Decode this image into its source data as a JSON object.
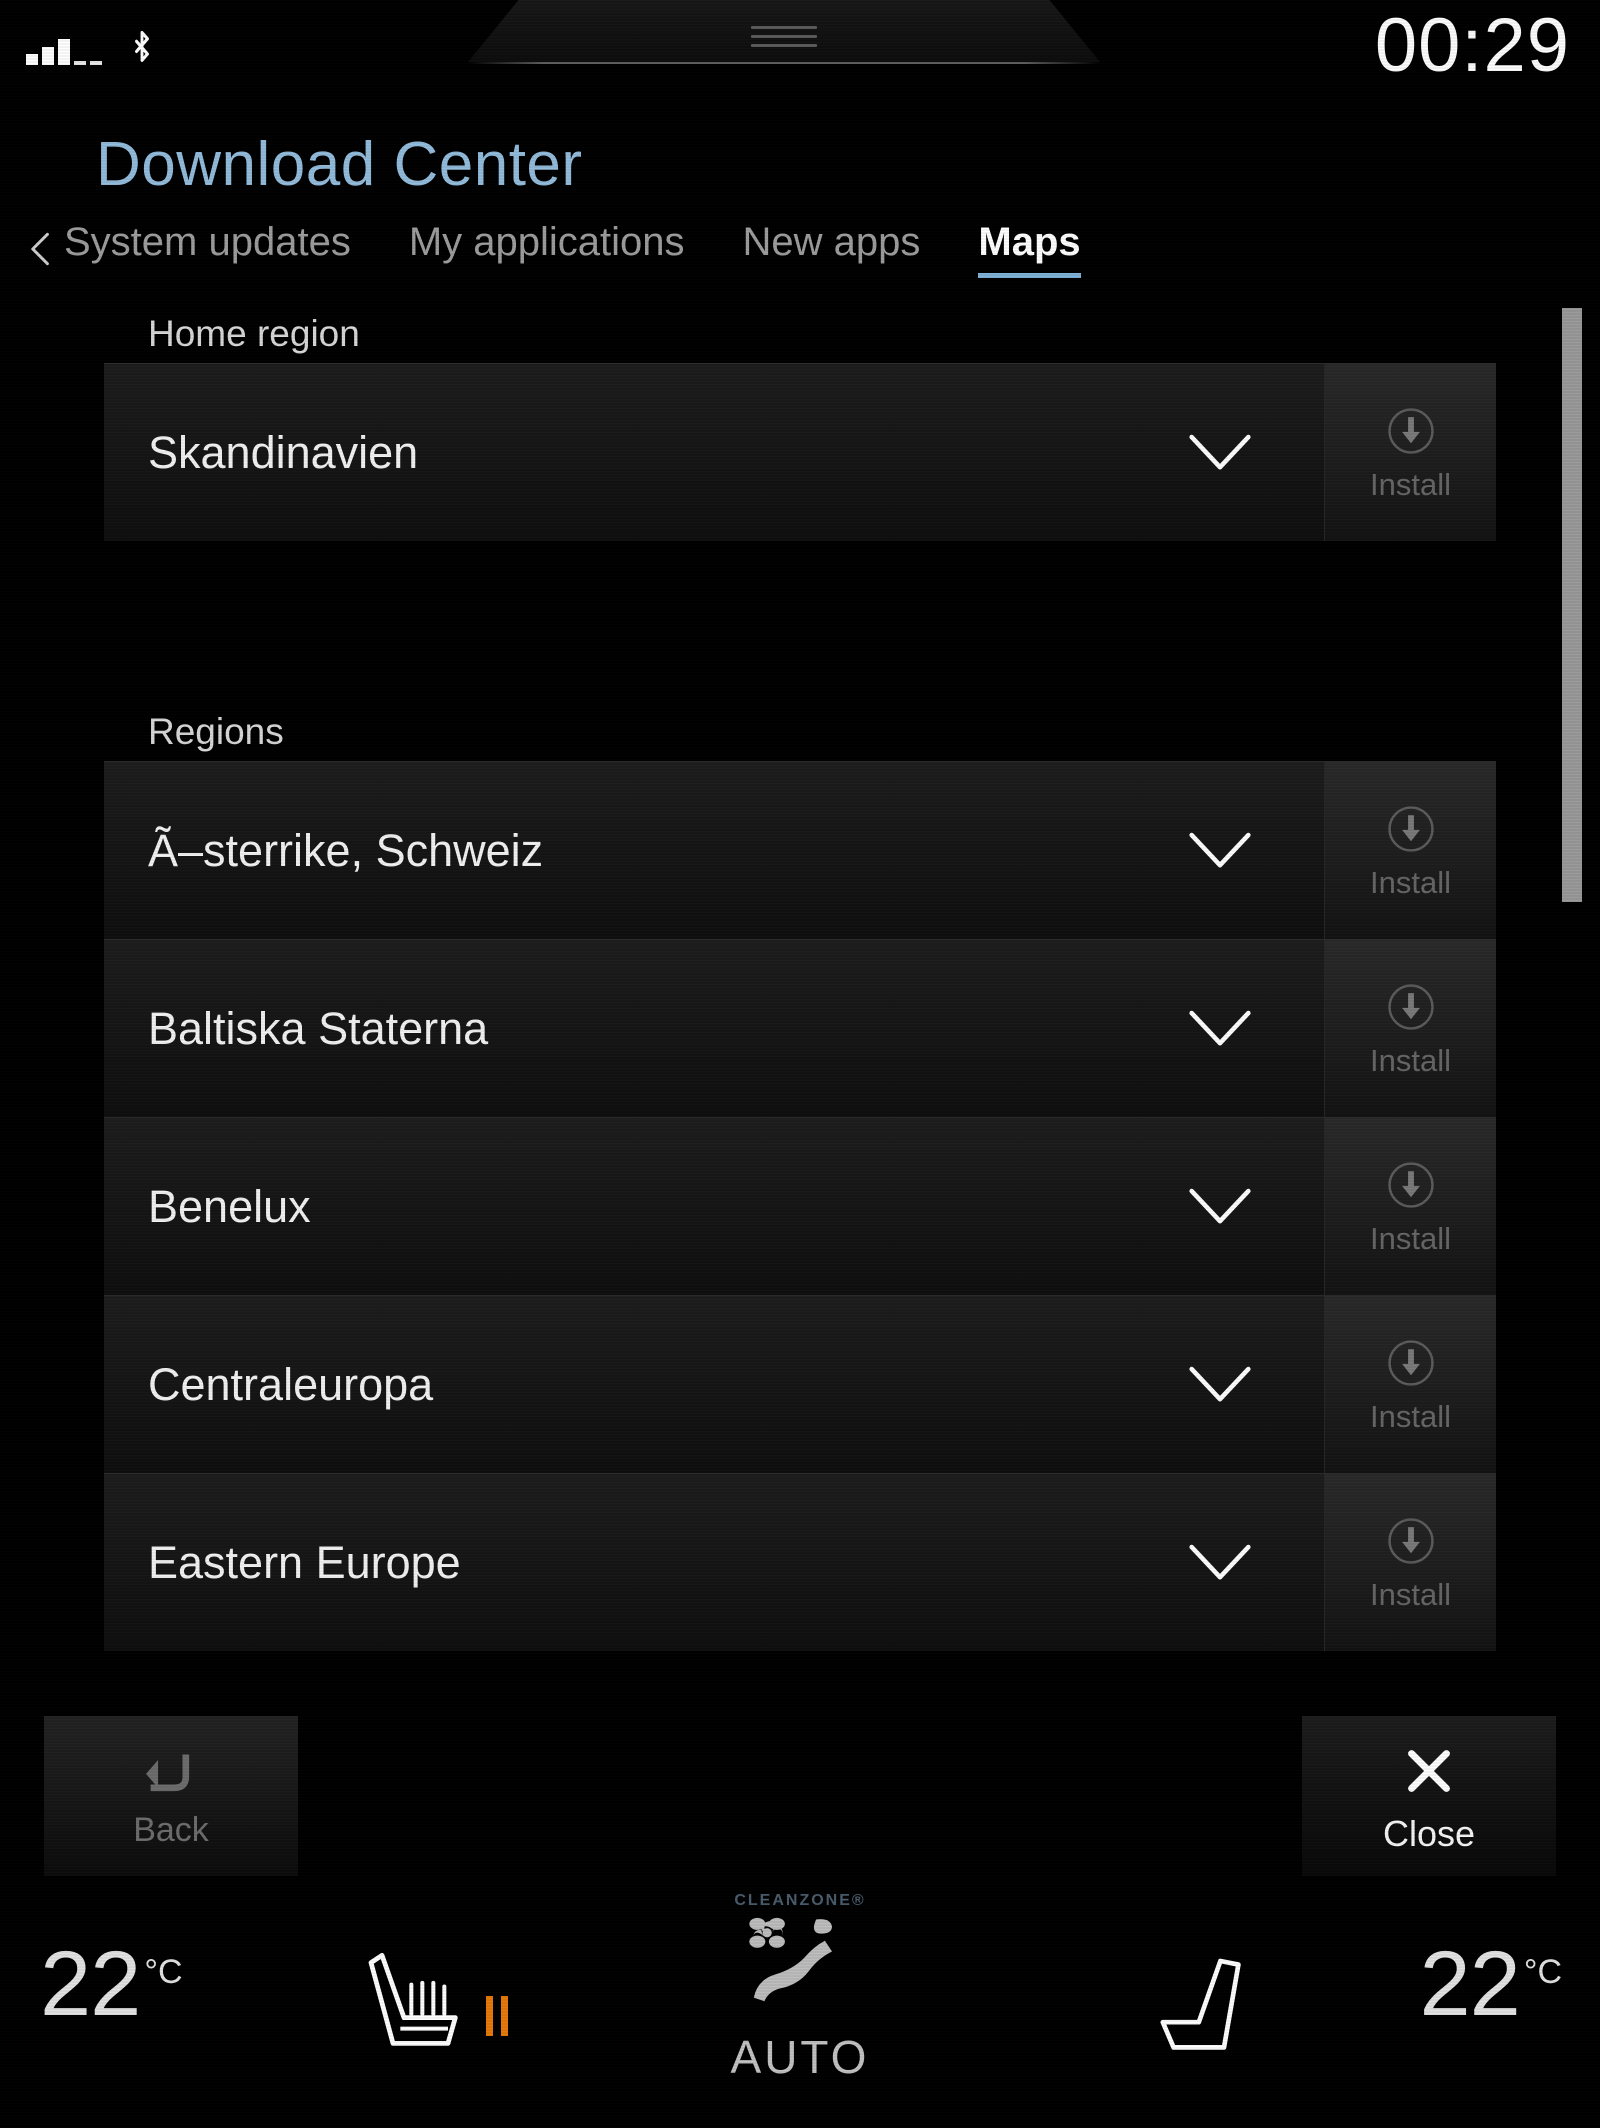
{
  "statusbar": {
    "clock": "00:29",
    "signal_icon": "signal-bars-icon",
    "signal_bars_filled": 3,
    "signal_bars_empty": 2,
    "bluetooth_icon": "bluetooth-icon",
    "pulldown_icon": "pulldown-handle-icon"
  },
  "header": {
    "title": "Download Center",
    "back_icon": "chevron-left-icon",
    "tabs": [
      {
        "label": "System updates",
        "active": false
      },
      {
        "label": "My applications",
        "active": false
      },
      {
        "label": "New apps",
        "active": false
      },
      {
        "label": "Maps",
        "active": true
      }
    ]
  },
  "main": {
    "home_region": {
      "section_label": "Home region",
      "rows": [
        {
          "name": "Skandinavien",
          "expand_icon": "chevron-down-icon",
          "install_icon": "download-circle-icon",
          "install_label": "Install",
          "install_enabled": false
        }
      ]
    },
    "regions": {
      "section_label": "Regions",
      "rows": [
        {
          "name": "Ã–sterrike, Schweiz",
          "expand_icon": "chevron-down-icon",
          "install_icon": "download-circle-icon",
          "install_label": "Install",
          "install_enabled": false
        },
        {
          "name": "Baltiska Staterna",
          "expand_icon": "chevron-down-icon",
          "install_icon": "download-circle-icon",
          "install_label": "Install",
          "install_enabled": false
        },
        {
          "name": "Benelux",
          "expand_icon": "chevron-down-icon",
          "install_icon": "download-circle-icon",
          "install_label": "Install",
          "install_enabled": false
        },
        {
          "name": "Centraleuropa",
          "expand_icon": "chevron-down-icon",
          "install_icon": "download-circle-icon",
          "install_label": "Install",
          "install_enabled": false
        },
        {
          "name": "Eastern Europe",
          "expand_icon": "chevron-down-icon",
          "install_icon": "download-circle-icon",
          "install_label": "Install",
          "install_enabled": false
        }
      ]
    },
    "scrollbar": {
      "icon": "vertical-scrollbar"
    }
  },
  "bottom_nav": {
    "back": {
      "label": "Back",
      "icon": "return-arrow-icon",
      "enabled": false
    },
    "close": {
      "label": "Close",
      "icon": "close-x-icon",
      "enabled": true
    }
  },
  "climate": {
    "left_temp_value": "22",
    "left_temp_unit": "°C",
    "right_temp_value": "22",
    "right_temp_unit": "°C",
    "left_seat_icon": "heated-seat-icon",
    "left_seat_level": 2,
    "right_seat_icon": "seat-icon",
    "right_seat_level": 0,
    "cleanzone_brand": "CLEANZONE®",
    "airflow_icon": "fan-airflow-seat-icon",
    "auto_label": "AUTO"
  },
  "colors": {
    "title_blue": "#93bcdc",
    "tab_active_underline": "#7fb2d8",
    "seat_heat_orange": "#e8790a",
    "background": "#000000",
    "row_bg": "#1a1a1a"
  }
}
